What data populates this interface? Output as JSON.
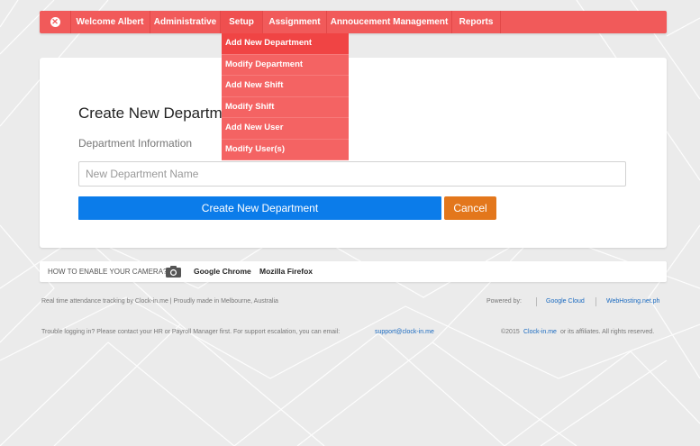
{
  "nav": {
    "home_icon": "close-circle-icon",
    "items": [
      {
        "label": "Welcome Albert"
      },
      {
        "label": "Administrative"
      },
      {
        "label": "Setup"
      },
      {
        "label": "Assignment"
      },
      {
        "label": "Annoucement Management"
      },
      {
        "label": "Reports"
      }
    ]
  },
  "dropdown": {
    "items": [
      {
        "label": "Add New Department"
      },
      {
        "label": "Modify Department"
      },
      {
        "label": "Add New Shift"
      },
      {
        "label": "Modify Shift"
      },
      {
        "label": "Add New User"
      },
      {
        "label": "Modify User(s)"
      }
    ]
  },
  "form": {
    "title": "Create New Department",
    "subtitle": "Department Information",
    "name_placeholder": "New Department Name",
    "name_value": "",
    "create_label": "Create New Department",
    "cancel_label": "Cancel"
  },
  "camera": {
    "prompt": "HOW TO ENABLE YOUR CAMERA?",
    "icon": "camera-icon",
    "browsers": [
      "Google Chrome",
      "Mozilla Firefox"
    ]
  },
  "footer": {
    "tagline": "Real time attendance tracking by Clock-in.me  |  Proudly made in Melbourne, Australia",
    "powered_by": "Powered by:",
    "sponsors": [
      "Google Cloud",
      "WebHosting.net.ph"
    ],
    "help_text": "Trouble logging in? Please contact your HR or Payroll Manager first. For support escalation, you can email:",
    "support_email": "support@clock-in.me",
    "copyright_prefix": "©2015",
    "copyright_link": "Clock-in.me",
    "copyright_suffix": "or its affiliates. All rights reserved."
  },
  "colors": {
    "nav_red": "#f15a5a",
    "primary_blue": "#0b7cea",
    "cancel_orange": "#e3771c",
    "link_blue": "#1a6ac0"
  }
}
